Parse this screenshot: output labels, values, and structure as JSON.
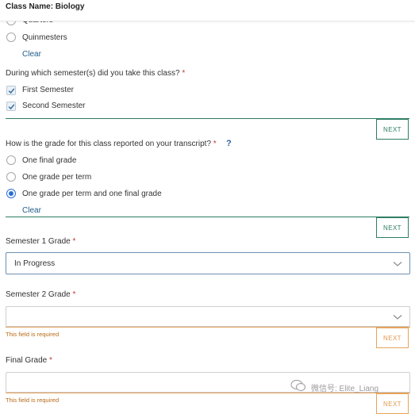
{
  "header": {
    "title": "Class Name: Biology"
  },
  "term_options": [
    {
      "label": "Quarters"
    },
    {
      "label": "Quinmesters"
    }
  ],
  "term_clear": "Clear",
  "semester_question": {
    "text": "During which semester(s) did you take this class?",
    "required_mark": "*"
  },
  "semester_options": [
    {
      "label": "First Semester",
      "checked": true
    },
    {
      "label": "Second Semester",
      "checked": true
    }
  ],
  "next_label": "NEXT",
  "grade_question": {
    "text": "How is the grade for this class reported on your transcript?",
    "required_mark": "*",
    "help": "?"
  },
  "grade_options": [
    {
      "label": "One final grade",
      "selected": false
    },
    {
      "label": "One grade per term",
      "selected": false
    },
    {
      "label": "One grade per term and one final grade",
      "selected": true
    }
  ],
  "grade_clear": "Clear",
  "sem1": {
    "label": "Semester 1 Grade",
    "required_mark": "*",
    "value": "In Progress"
  },
  "sem2": {
    "label": "Semester 2 Grade",
    "required_mark": "*",
    "value": "",
    "error": "This field is required"
  },
  "final": {
    "label": "Final Grade",
    "required_mark": "*",
    "value": "",
    "error": "This field is required"
  },
  "watermark": {
    "text": "微信号: Elite_Liang"
  },
  "colors": {
    "accent_green": "#2e7d64",
    "error_orange": "#e5a15a",
    "link_blue": "#1e5c8a",
    "radio_blue": "#2b6ed4"
  }
}
